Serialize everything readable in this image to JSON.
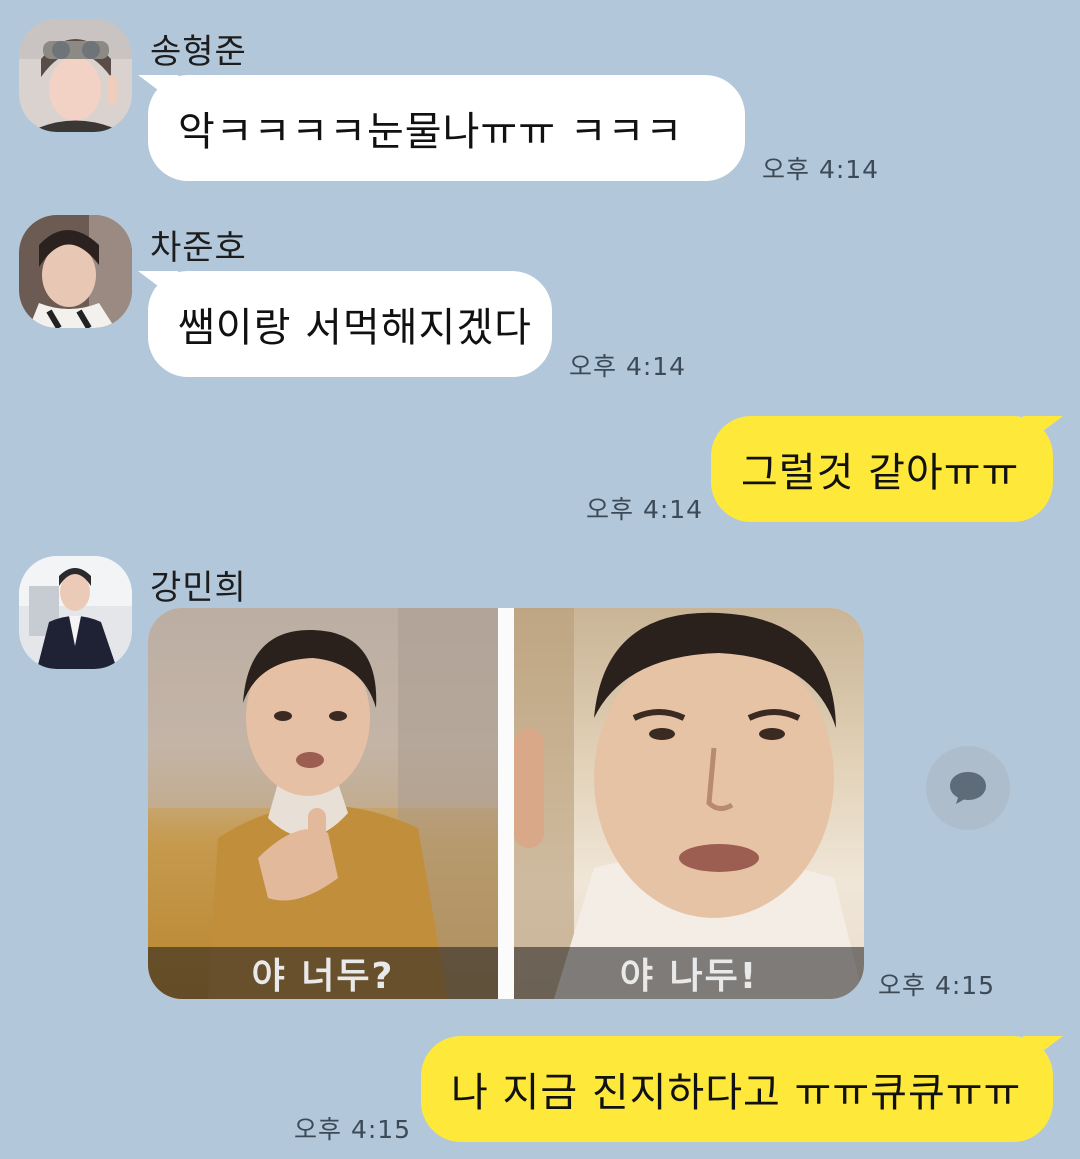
{
  "messages": [
    {
      "sender": "송형준",
      "text": "악ㅋㅋㅋㅋ눈물나ㅠㅠ ㅋㅋㅋ",
      "time": "오후 4:14"
    },
    {
      "sender": "차준호",
      "text": "쌤이랑 서먹해지겠다",
      "time": "오후 4:14"
    },
    {
      "sender": "",
      "text": "그럴것 같아ㅠㅠ",
      "time": "오후 4:14"
    },
    {
      "sender": "강민희",
      "image_captions": [
        "야 너두?",
        "야 나두!"
      ],
      "time": "오후 4:15"
    },
    {
      "sender": "",
      "text": "나 지금 진지하다고 ㅠㅠ큐큐ㅠㅠ",
      "time": "오후 4:15"
    }
  ],
  "colors": {
    "background": "#B2C7DA",
    "incoming_bubble": "#FFFFFF",
    "outgoing_bubble": "#FEE93B"
  },
  "icons": {
    "share": "chat-bubble-icon"
  }
}
